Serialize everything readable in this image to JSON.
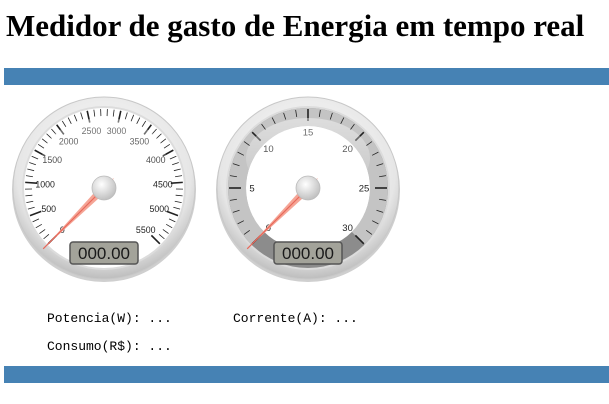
{
  "page": {
    "title": "Medidor de gasto de Energia em tempo real"
  },
  "theme": {
    "bar_color": "#4682b4"
  },
  "gauges": [
    {
      "name": "power",
      "min": 0,
      "max": 5500,
      "value": 0,
      "display": "000.00",
      "tick_labels": [
        "0",
        "500",
        "1000",
        "1500",
        "2000",
        "2500",
        "3000",
        "3500",
        "4000",
        "4500",
        "5000",
        "5500"
      ],
      "face": "light"
    },
    {
      "name": "current",
      "min": 0,
      "max": 30,
      "value": 0,
      "display": "000.00",
      "tick_labels": [
        "0",
        "5",
        "10",
        "15",
        "20",
        "25",
        "30"
      ],
      "face": "dark"
    }
  ],
  "readouts": {
    "potencia": "Potencia(W): ...",
    "corrente": "Corrente(A): ...",
    "consumo": "Consumo(R$): ..."
  }
}
